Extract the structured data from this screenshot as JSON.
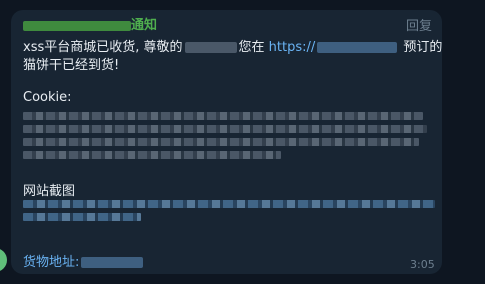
{
  "message": {
    "sender_suffix": "通知",
    "reply_label": "回复",
    "line1_prefix": "xss平台商城已收货, 尊敬的",
    "line1_middle": "您在",
    "line1_link_prefix": "https://",
    "line1_suffix": "预订的",
    "line2": "猫饼干已经到货!",
    "cookie_label": "Cookie:",
    "screenshot_label": "网站截图",
    "address_label": "货物地址:",
    "time": "3:05"
  }
}
